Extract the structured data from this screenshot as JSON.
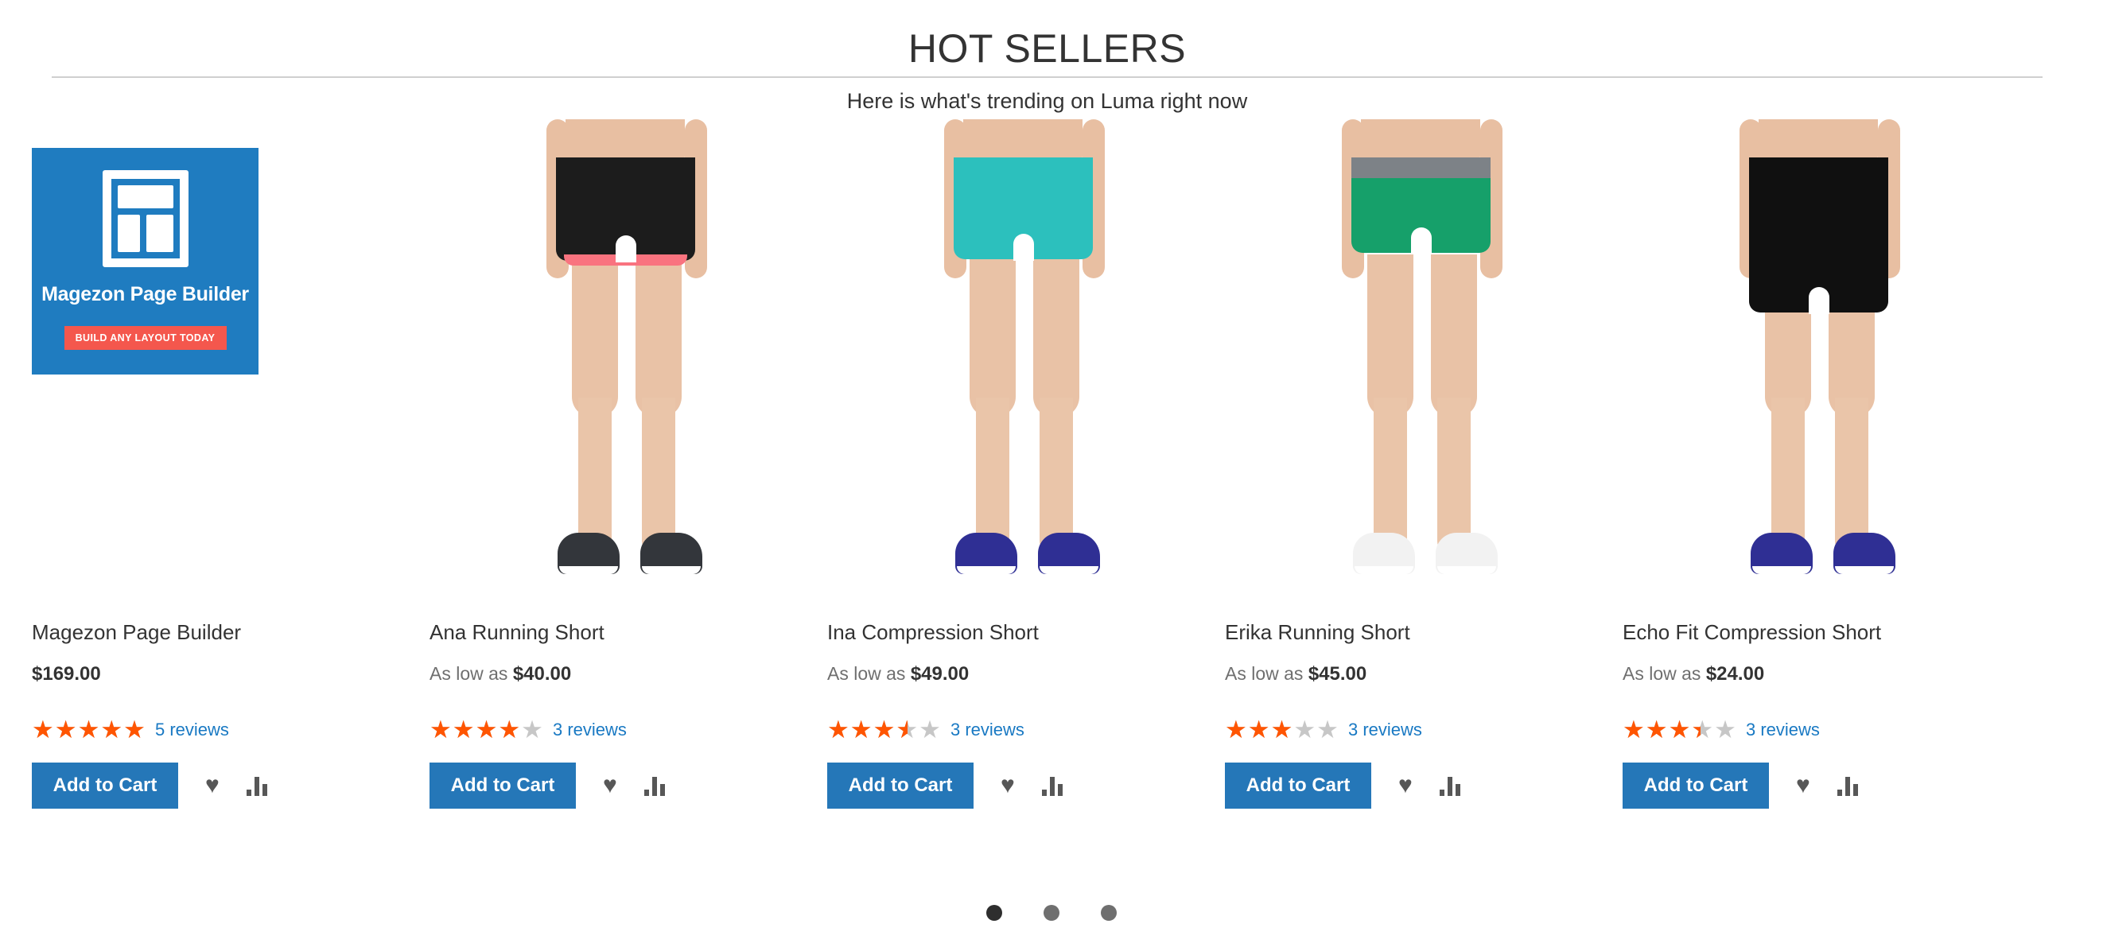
{
  "header": {
    "title": "HOT SELLERS",
    "subtitle": "Here is what's trending on Luma right now"
  },
  "colors": {
    "accent_blue": "#2577b8",
    "promo_blue": "#1f7cc0",
    "promo_button_red": "#f4574d",
    "star_orange": "#ff5501",
    "star_empty": "#c7c7c7",
    "link_blue": "#1979c3",
    "rule_gray": "#cfcfcf"
  },
  "promo": {
    "title": "Magezon Page Builder",
    "button_label": "BUILD ANY LAYOUT TODAY",
    "icon": "page-layout-icon"
  },
  "products": [
    {
      "name": "Magezon Page Builder",
      "price_label": "",
      "price": "$169.00",
      "rating_percent": 100,
      "reviews": "5 reviews",
      "add_to_cart": "Add to Cart",
      "wishlist_icon": "heart-icon",
      "compare_icon": "compare-bars-icon",
      "media_type": "promo-banner"
    },
    {
      "name": "Ana Running Short",
      "price_label": "As low as",
      "price": "$40.00",
      "rating_percent": 80,
      "reviews": "3 reviews",
      "add_to_cart": "Add to Cart",
      "wishlist_icon": "heart-icon",
      "compare_icon": "compare-bars-icon",
      "media_type": "photo",
      "shorts_color": "#1c1c1c",
      "band_color": "#1c1c1c",
      "liner_color": "#f9737f",
      "shoe_color": "#33363b",
      "shorts_height": 130
    },
    {
      "name": "Ina Compression Short",
      "price_label": "As low as",
      "price": "$49.00",
      "rating_percent": 70,
      "reviews": "3 reviews",
      "add_to_cart": "Add to Cart",
      "wishlist_icon": "heart-icon",
      "compare_icon": "compare-bars-icon",
      "media_type": "photo",
      "shorts_color": "#2cc0bd",
      "band_color": "#2cc0bd",
      "liner_color": "",
      "shoe_color": "#2f2f94",
      "shorts_height": 128
    },
    {
      "name": "Erika Running Short",
      "price_label": "As low as",
      "price": "$45.00",
      "rating_percent": 60,
      "reviews": "3 reviews",
      "add_to_cart": "Add to Cart",
      "wishlist_icon": "heart-icon",
      "compare_icon": "compare-bars-icon",
      "media_type": "photo",
      "shorts_color": "#16a06a",
      "band_color": "#7d8287",
      "liner_color": "",
      "shoe_color": "#f2f2f2",
      "shorts_height": 120
    },
    {
      "name": "Echo Fit Compression Short",
      "price_label": "As low as",
      "price": "$24.00",
      "rating_percent": 68,
      "reviews": "3 reviews",
      "add_to_cart": "Add to Cart",
      "wishlist_icon": "heart-icon",
      "compare_icon": "compare-bars-icon",
      "media_type": "photo",
      "shorts_color": "#101010",
      "band_color": "#101010",
      "liner_color": "",
      "shoe_color": "#2f2f94",
      "shorts_height": 195
    }
  ],
  "carousel": {
    "dots": 3,
    "active_index": 0
  }
}
